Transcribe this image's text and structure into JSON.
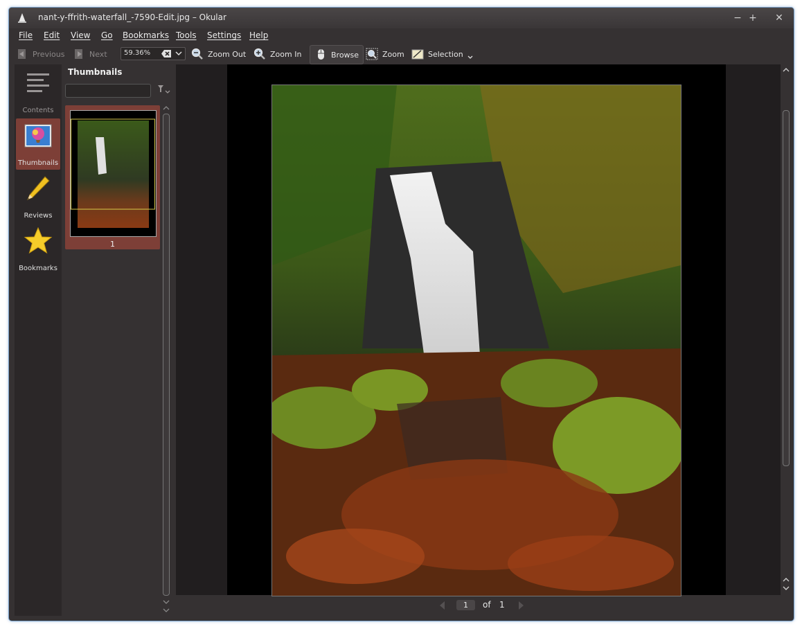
{
  "window": {
    "title": "nant-y-ffrith-waterfall_-7590-Edit.jpg – Okular",
    "minimize_glyph": "−",
    "maximize_glyph": "+",
    "close_glyph": "✕"
  },
  "menu": [
    "File",
    "Edit",
    "View",
    "Go",
    "Bookmarks",
    "Tools",
    "Settings",
    "Help"
  ],
  "toolbar": {
    "previous": "Previous",
    "next": "Next",
    "zoom_value": "59.36%",
    "zoom_out": "Zoom Out",
    "zoom_in": "Zoom In",
    "browse": "Browse",
    "zoom": "Zoom",
    "selection": "Selection"
  },
  "sidebar": {
    "items": [
      {
        "label": "Contents",
        "icon": "contents-icon"
      },
      {
        "label": "Thumbnails",
        "icon": "thumbnails-icon"
      },
      {
        "label": "Reviews",
        "icon": "pencil-icon"
      },
      {
        "label": "Bookmarks",
        "icon": "star-icon"
      }
    ]
  },
  "thumbnails": {
    "title": "Thumbnails",
    "filter_placeholder": "",
    "items": [
      {
        "page": "1"
      }
    ]
  },
  "status": {
    "current_page": "1",
    "of_label": "of",
    "total_pages": "1"
  },
  "colors": {
    "accent": "#7d3f37",
    "window_bg": "#353132",
    "viewer_bg": "#211e1f"
  }
}
